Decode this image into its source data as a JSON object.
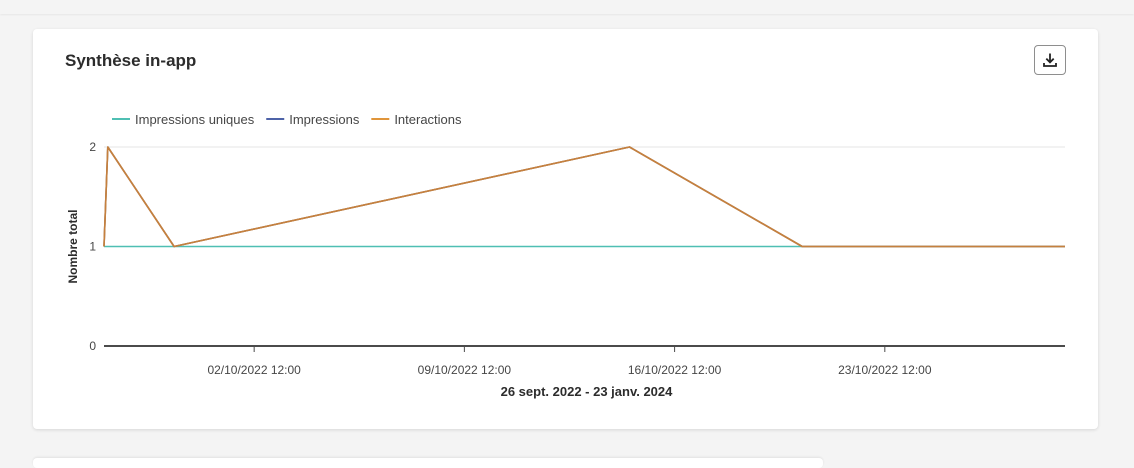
{
  "card": {
    "title": "Synthèse in-app",
    "download_icon": "download-icon"
  },
  "chart_data": {
    "type": "line",
    "title": "",
    "ylabel": "Nombre total",
    "xlabel": "26 sept. 2022 - 23 janv. 2024",
    "ylim": [
      0,
      2
    ],
    "yticks": [
      "0",
      "1",
      "2"
    ],
    "xticks": [
      {
        "label": "02/10/2022 12:00",
        "x": "2022-10-02T12:00"
      },
      {
        "label": "09/10/2022 12:00",
        "x": "2022-10-09T12:00"
      },
      {
        "label": "16/10/2022 12:00",
        "x": "2022-10-16T12:00"
      },
      {
        "label": "23/10/2022 12:00",
        "x": "2022-10-23T12:00"
      }
    ],
    "xlim": [
      "2022-09-27T12:00",
      "2022-10-29T12:00"
    ],
    "grid": true,
    "legend_position": "top-left",
    "series": [
      {
        "name": "Impressions uniques",
        "color": "#4fbfb3",
        "points": [
          {
            "x": "2022-09-27T12:00",
            "y": 1
          },
          {
            "x": "2022-10-29T12:00",
            "y": 1
          }
        ]
      },
      {
        "name": "Impressions",
        "color": "#4e63a8",
        "points": [
          {
            "x": "2022-09-27T12:00",
            "y": 1
          },
          {
            "x": "2022-09-27T15:00",
            "y": 2
          },
          {
            "x": "2022-09-29T20:00",
            "y": 1
          },
          {
            "x": "2022-10-15T00:00",
            "y": 2
          },
          {
            "x": "2022-10-20T18:00",
            "y": 1
          },
          {
            "x": "2022-10-29T12:00",
            "y": 1
          }
        ]
      },
      {
        "name": "Interactions",
        "color": "#e0953a",
        "points": [
          {
            "x": "2022-09-27T12:00",
            "y": 1
          },
          {
            "x": "2022-09-27T15:00",
            "y": 2
          },
          {
            "x": "2022-09-29T20:00",
            "y": 1
          },
          {
            "x": "2022-10-15T00:00",
            "y": 2
          },
          {
            "x": "2022-10-20T18:00",
            "y": 1
          },
          {
            "x": "2022-10-29T12:00",
            "y": 1
          }
        ]
      }
    ]
  }
}
